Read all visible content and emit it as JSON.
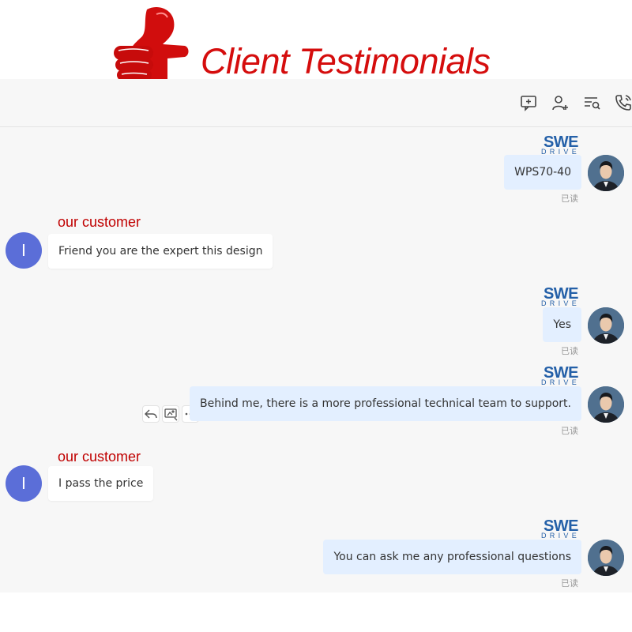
{
  "banner": {
    "title": "Client Testimonials",
    "thumb_icon": "thumbs-up-icon",
    "color": "#d50d0d"
  },
  "toolbar": {
    "icons": [
      "message-add-icon",
      "add-user-icon",
      "search-history-icon",
      "phone-call-icon"
    ]
  },
  "brand": {
    "line1": "SWE",
    "line2": "DRIVE"
  },
  "customer_label": "our customer",
  "customer_initial": "I",
  "read_label": "已读",
  "messages": [
    {
      "side": "outgoing",
      "text": "WPS70-40"
    },
    {
      "side": "incoming",
      "text": "Friend you are the expert this design"
    },
    {
      "side": "outgoing",
      "text": "Yes"
    },
    {
      "side": "outgoing",
      "text": "Behind me, there is a more professional technical team to support."
    },
    {
      "side": "incoming",
      "text": "I pass the price"
    },
    {
      "side": "outgoing",
      "text": "You can ask me any professional questions"
    }
  ],
  "hover_actions": [
    "reply-icon",
    "screenshot-icon",
    "more-icon"
  ],
  "colors": {
    "outgoing_bubble": "#e3efff",
    "incoming_bubble": "#ffffff",
    "customer_label": "#c00000",
    "brand": "#2460a8",
    "avatar": "#5b6ed8"
  }
}
